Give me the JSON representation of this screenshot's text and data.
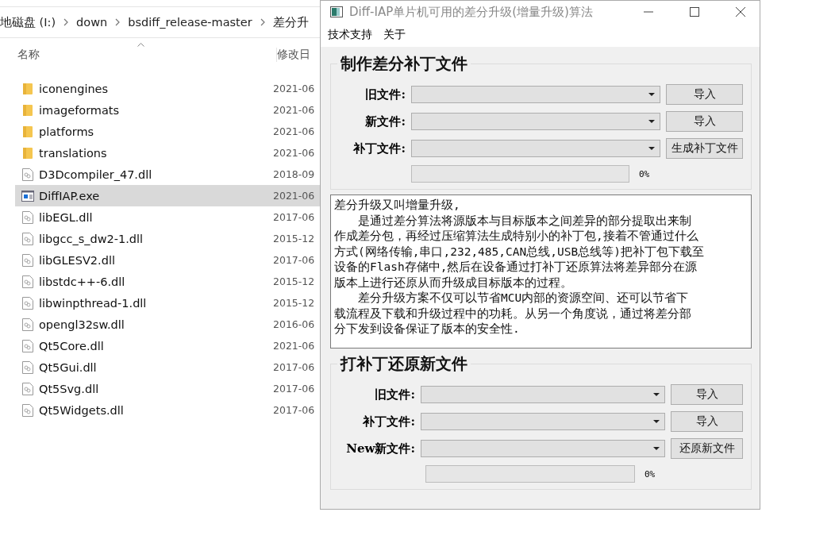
{
  "explorer": {
    "breadcrumb": [
      "地磁盘 (I:)",
      "down",
      "bsdiff_release-master",
      "差分升"
    ],
    "columns": [
      "名称",
      "修改日"
    ],
    "files": [
      {
        "name": "iconengines",
        "date": "2021-06",
        "kind": "folder",
        "selected": false
      },
      {
        "name": "imageformats",
        "date": "2021-06",
        "kind": "folder",
        "selected": false
      },
      {
        "name": "platforms",
        "date": "2021-06",
        "kind": "folder",
        "selected": false
      },
      {
        "name": "translations",
        "date": "2021-06",
        "kind": "folder",
        "selected": false
      },
      {
        "name": "D3Dcompiler_47.dll",
        "date": "2018-09",
        "kind": "dll",
        "selected": false
      },
      {
        "name": "DiffIAP.exe",
        "date": "2021-06",
        "kind": "exe",
        "selected": true
      },
      {
        "name": "libEGL.dll",
        "date": "2017-06",
        "kind": "dll",
        "selected": false
      },
      {
        "name": "libgcc_s_dw2-1.dll",
        "date": "2015-12",
        "kind": "dll",
        "selected": false
      },
      {
        "name": "libGLESV2.dll",
        "date": "2017-06",
        "kind": "dll",
        "selected": false
      },
      {
        "name": "libstdc++-6.dll",
        "date": "2015-12",
        "kind": "dll",
        "selected": false
      },
      {
        "name": "libwinpthread-1.dll",
        "date": "2015-12",
        "kind": "dll",
        "selected": false
      },
      {
        "name": "opengl32sw.dll",
        "date": "2016-06",
        "kind": "dll",
        "selected": false
      },
      {
        "name": "Qt5Core.dll",
        "date": "2021-06",
        "kind": "dll",
        "selected": false
      },
      {
        "name": "Qt5Gui.dll",
        "date": "2017-06",
        "kind": "dll",
        "selected": false
      },
      {
        "name": "Qt5Svg.dll",
        "date": "2017-06",
        "kind": "dll",
        "selected": false
      },
      {
        "name": "Qt5Widgets.dll",
        "date": "2017-06",
        "kind": "dll",
        "selected": false
      }
    ]
  },
  "window": {
    "title": "Diff-IAP单片机可用的差分升级(增量升级)算法",
    "menu": [
      "技术支持",
      "关于"
    ],
    "make_group": {
      "title": "制作差分补丁文件",
      "rows": [
        {
          "label": "旧文件:",
          "button": "导入"
        },
        {
          "label": "新文件:",
          "button": "导入"
        },
        {
          "label": "补丁文件:",
          "button": "生成补丁文件"
        }
      ],
      "progress": {
        "level": 0,
        "reading": "0%"
      }
    },
    "description": [
      "差分升级又叫增量升级,",
      "　　是通过差分算法将源版本与目标版本之间差异的部分提取出来制",
      "作成差分包，再经过压缩算法生成特别小的补丁包,接着不管通过什么",
      "方式(网络传输,串口,232,485,CAN总线,USB总线等)把补丁包下载至",
      "设备的Flash存储中,然后在设备通过打补丁还原算法将差异部分在源",
      "版本上进行还原从而升级成目标版本的过程。",
      "　　差分升级方案不仅可以节省MCU内部的资源空间、还可以节省下",
      "载流程及下载和升级过程中的功耗。从另一个角度说，通过将差分部",
      "分下发到设备保证了版本的安全性."
    ],
    "restore_group": {
      "title": "打补丁还原新文件",
      "rows": [
        {
          "label": "旧文件:",
          "button": "导入"
        },
        {
          "label": "补丁文件:",
          "button": "导入"
        },
        {
          "label": "New新文件:",
          "button": "还原新文件"
        }
      ],
      "progress": {
        "level": 0,
        "reading": "0%"
      }
    }
  }
}
